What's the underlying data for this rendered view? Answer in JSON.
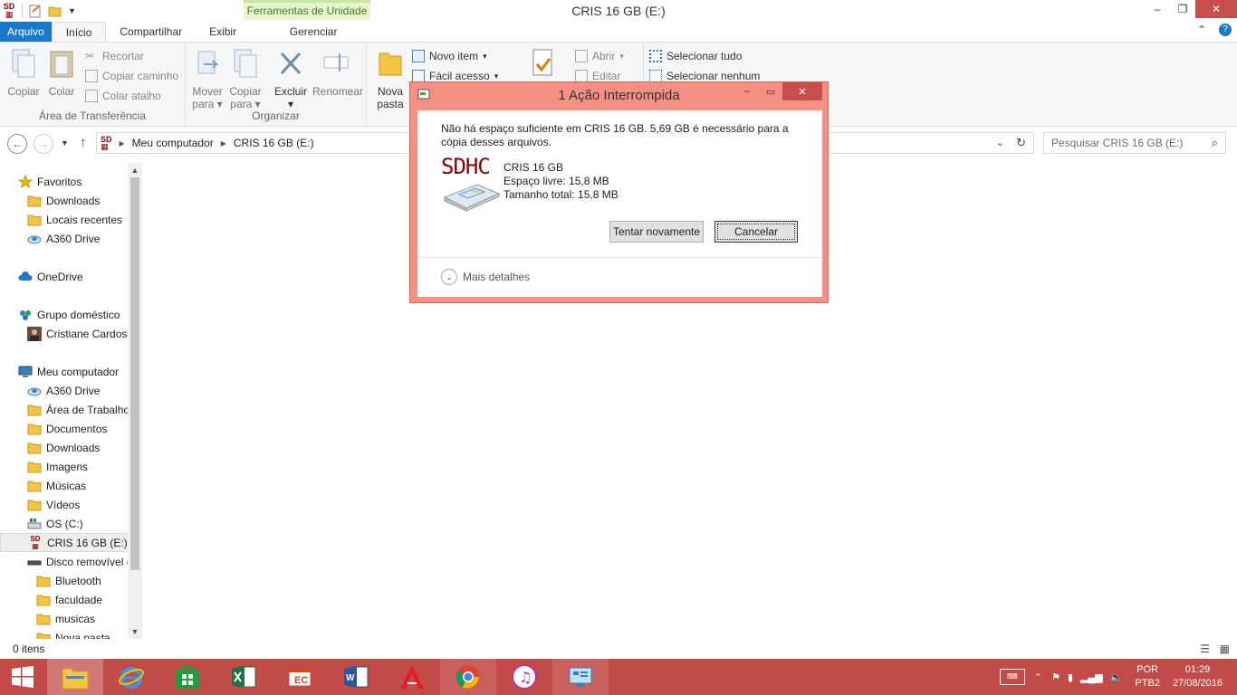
{
  "window": {
    "title": "CRIS 16 GB (E:)",
    "tools_header": "Ferramentas de Unidade",
    "controls": {
      "minimize": "–",
      "maximize": "❐",
      "close": "✕"
    }
  },
  "tabs": [
    "Arquivo",
    "Início",
    "Compartilhar",
    "Exibir",
    "Gerenciar"
  ],
  "ribbon": {
    "clipboard": {
      "label": "Área de Transferência",
      "copy": "Copiar",
      "paste": "Colar",
      "cut": "Recortar",
      "copy_path": "Copiar caminho",
      "paste_shortcut": "Colar atalho"
    },
    "organize": {
      "label": "Organizar",
      "move_to": [
        "Mover",
        "para"
      ],
      "copy_to": [
        "Copiar",
        "para"
      ],
      "delete": "Excluir",
      "rename": "Renomear"
    },
    "new": {
      "new_folder": [
        "Nova",
        "pasta"
      ],
      "new_item": "Novo item",
      "easy_access": "Fácil acesso"
    },
    "open": {
      "open": "Abrir",
      "edit": "Editar"
    },
    "select": {
      "select_all": "Selecionar tudo",
      "select_none": "Selecionar nenhum"
    }
  },
  "address": {
    "crumbs": [
      "Meu computador",
      "CRIS 16 GB (E:)"
    ],
    "search_placeholder": "Pesquisar CRIS 16 GB (E:)"
  },
  "nav": [
    {
      "label": "Favoritos",
      "indent": 0,
      "icon": "star-icon"
    },
    {
      "label": "Downloads",
      "indent": 1,
      "icon": "folder-icon"
    },
    {
      "label": "Locais recentes",
      "indent": 1,
      "icon": "folder-icon"
    },
    {
      "label": "A360 Drive",
      "indent": 1,
      "icon": "cloud-drive-icon"
    },
    {
      "label": "OneDrive",
      "indent": 0,
      "icon": "cloud-icon"
    },
    {
      "label": "Grupo doméstico",
      "indent": 0,
      "icon": "homegroup-icon"
    },
    {
      "label": "Cristiane Cardoso",
      "indent": 1,
      "icon": "user-photo-icon"
    },
    {
      "label": "Meu computador",
      "indent": 0,
      "icon": "computer-icon"
    },
    {
      "label": "A360 Drive",
      "indent": 1,
      "icon": "cloud-drive-icon"
    },
    {
      "label": "Área de Trabalho",
      "indent": 1,
      "icon": "folder-icon"
    },
    {
      "label": "Documentos",
      "indent": 1,
      "icon": "folder-icon"
    },
    {
      "label": "Downloads",
      "indent": 1,
      "icon": "folder-icon"
    },
    {
      "label": "Imagens",
      "indent": 1,
      "icon": "folder-icon"
    },
    {
      "label": "Músicas",
      "indent": 1,
      "icon": "folder-icon"
    },
    {
      "label": "Vídeos",
      "indent": 1,
      "icon": "folder-icon"
    },
    {
      "label": "OS (C:)",
      "indent": 1,
      "icon": "drive-icon"
    },
    {
      "label": "CRIS 16 GB (E:)",
      "indent": 1,
      "icon": "sd-card-icon",
      "selected": true
    },
    {
      "label": "Disco removível (F:)",
      "indent": 1,
      "icon": "removable-drive-icon"
    },
    {
      "label": "Bluetooth",
      "indent": 2,
      "icon": "folder-icon"
    },
    {
      "label": "faculdade",
      "indent": 2,
      "icon": "folder-icon"
    },
    {
      "label": "musicas",
      "indent": 2,
      "icon": "folder-icon"
    },
    {
      "label": "Nova pasta",
      "indent": 2,
      "icon": "folder-icon"
    }
  ],
  "status": {
    "items": "0 itens"
  },
  "dialog": {
    "title": "1 Ação Interrompida",
    "message": "Não há espaço suficiente em CRIS 16 GB. 5,69 GB é necessário para a cópia desses arquivos.",
    "logo_text": "SDHC",
    "drive_name": "CRIS 16 GB",
    "free_space": "Espaço livre: 15,8 MB",
    "total_size": "Tamanho total: 15,8 MB",
    "retry": "Tentar novamente",
    "cancel": "Cancelar",
    "more_details": "Mais detalhes"
  },
  "tray": {
    "lang1": "POR",
    "lang2": "PTB2",
    "time": "01:29",
    "date": "27/08/2016"
  },
  "colors": {
    "accent": "#1979ca",
    "taskbar": "#c24a47",
    "dialog_frame": "#f38f83",
    "close_button": "#c7504c"
  }
}
